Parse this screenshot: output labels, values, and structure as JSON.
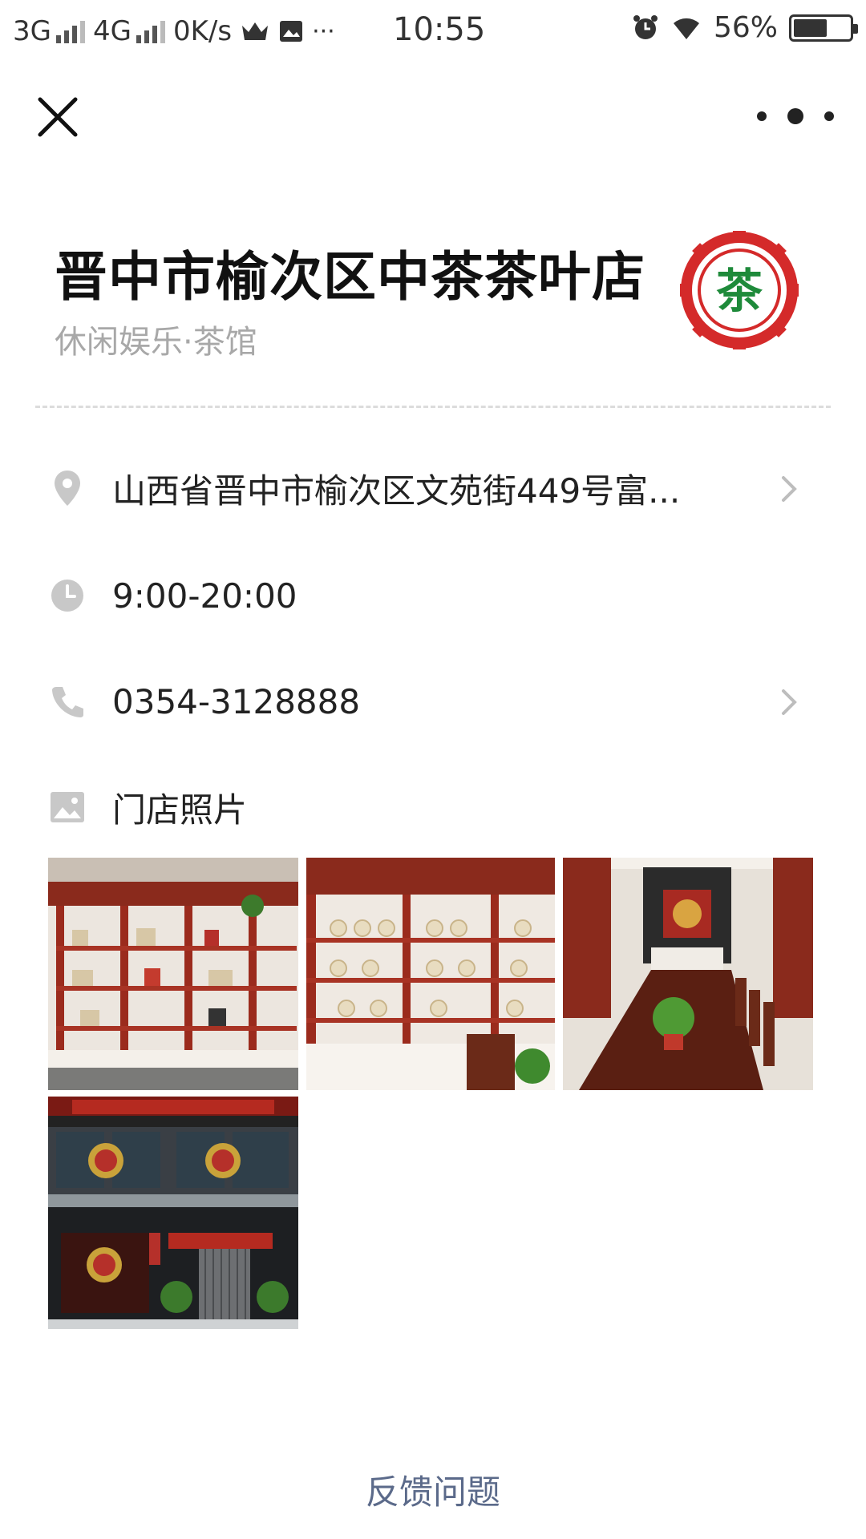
{
  "status_bar": {
    "net1": "3G",
    "net2": "4G",
    "speed": "0K/s",
    "more": "···",
    "time": "10:55",
    "battery": "56%"
  },
  "nav": {
    "close_icon": "close-icon",
    "more_icon": "more-icon"
  },
  "store": {
    "name": "晋中市榆次区中茶茶叶店",
    "category": "休闲娱乐·茶馆",
    "logo_text": "茶",
    "logo_colors": {
      "ring": "#d42a2a",
      "glyph": "#1e8a3a"
    }
  },
  "info": {
    "address": "山西省晋中市榆次区文苑街449号富...",
    "hours": "9:00-20:00",
    "phone": "0354-3128888",
    "photos_label": "门店照片"
  },
  "gallery": {
    "photos": [
      "shop-shelves-photo",
      "tea-display-photo",
      "tea-room-photo",
      "storefront-photo"
    ]
  },
  "footer": {
    "feedback": "反馈问题"
  },
  "colors": {
    "icon_gray": "#c8c8c8",
    "feedback_link": "#5b6a8a",
    "wood": "#8a2a1c"
  }
}
